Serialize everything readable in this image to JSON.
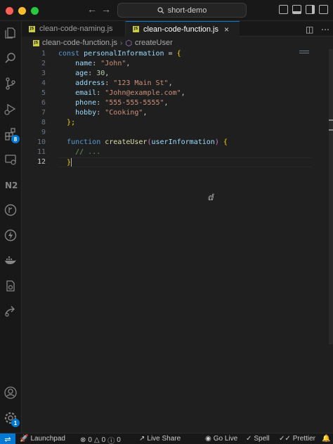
{
  "titlebar": {
    "search_text": "short-demo",
    "back_icon": "arrow-left",
    "forward_icon": "arrow-right"
  },
  "tabs": [
    {
      "label": "clean-code-naming.js",
      "active": false
    },
    {
      "label": "clean-code-function.js",
      "active": true
    }
  ],
  "breadcrumb": {
    "file": "clean-code-function.js",
    "symbol": "createUser"
  },
  "editor": {
    "line_numbers": [
      "1",
      "2",
      "3",
      "4",
      "5",
      "6",
      "7",
      "8",
      "9",
      "10",
      "11",
      "12"
    ],
    "current_line": 12
  },
  "code": {
    "l1_kw": "const",
    "l1_var": "personalInformation",
    "l1_eq": " = ",
    "l1_brace": "{",
    "l2_key": "name",
    "l2_val": "\"John\"",
    "l3_key": "age",
    "l3_val": "30",
    "l4_key": "address",
    "l4_val": "\"123 Main St\"",
    "l5_key": "email",
    "l5_val": "\"John@example.com\"",
    "l6_key": "phone",
    "l6_val": "\"555-555-5555\"",
    "l7_key": "hobby",
    "l7_val": "\"Cooking\"",
    "l8_close": "};",
    "l10_kw": "function",
    "l10_name": "createUser",
    "l10_param": "userInformation",
    "l11_comment": "// ...",
    "l12_close": "}"
  },
  "statusbar": {
    "launchpad": "Launchpad",
    "errors": "0",
    "warnings": "0",
    "info": "0",
    "live_share": "Live Share",
    "go_live": "Go Live",
    "spell": "Spell",
    "prettier": "Prettier"
  },
  "activity_badges": {
    "extensions": "8",
    "settings": "1"
  },
  "colors": {
    "accent": "#0078d4",
    "background": "#1f1f1f",
    "sidebar": "#181818"
  }
}
